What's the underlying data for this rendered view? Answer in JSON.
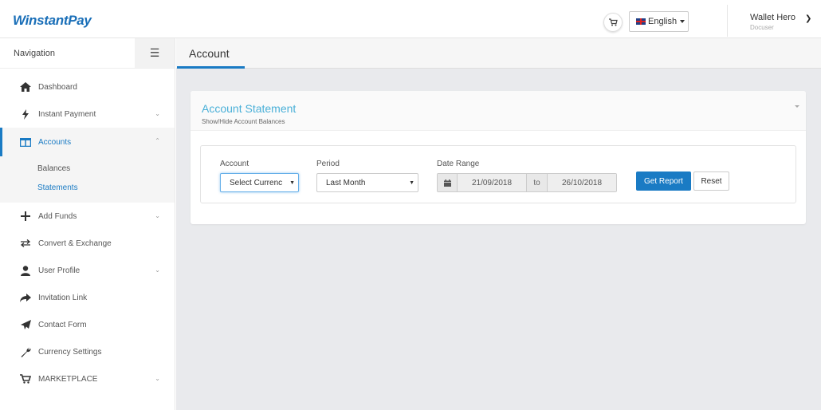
{
  "header": {
    "logo": "WinstantPay",
    "language": "English",
    "user_name": "Wallet Hero",
    "user_role": "Docuser"
  },
  "sidebar": {
    "title": "Navigation",
    "items": [
      {
        "label": "Dashboard",
        "icon": "home-icon"
      },
      {
        "label": "Instant Payment",
        "icon": "bolt-icon"
      },
      {
        "label": "Accounts",
        "icon": "columns-icon"
      },
      {
        "label": "Add Funds",
        "icon": "plus-icon"
      },
      {
        "label": "Convert & Exchange",
        "icon": "exchange-icon"
      },
      {
        "label": "User Profile",
        "icon": "user-icon"
      },
      {
        "label": "Invitation Link",
        "icon": "share-icon"
      },
      {
        "label": "Contact Form",
        "icon": "paper-plane-icon"
      },
      {
        "label": "Currency Settings",
        "icon": "wrench-icon"
      },
      {
        "label": "MARKETPLACE",
        "icon": "cart-icon"
      }
    ],
    "sub_items": [
      {
        "label": "Balances"
      },
      {
        "label": "Statements"
      }
    ]
  },
  "main": {
    "title": "Account",
    "card": {
      "title": "Account Statement",
      "subtitle": "Show/Hide Account Balances"
    },
    "filters": {
      "account_label": "Account",
      "account_value": "Select Currenc",
      "period_label": "Period",
      "period_value": "Last Month",
      "date_label": "Date Range",
      "date_from": "21/09/2018",
      "date_to_label": "to",
      "date_to": "26/10/2018",
      "get_report": "Get Report",
      "reset": "Reset"
    }
  },
  "colors": {
    "brand": "#1a6fb8",
    "accent": "#1a7bc4",
    "card_title": "#4ab0d8"
  }
}
